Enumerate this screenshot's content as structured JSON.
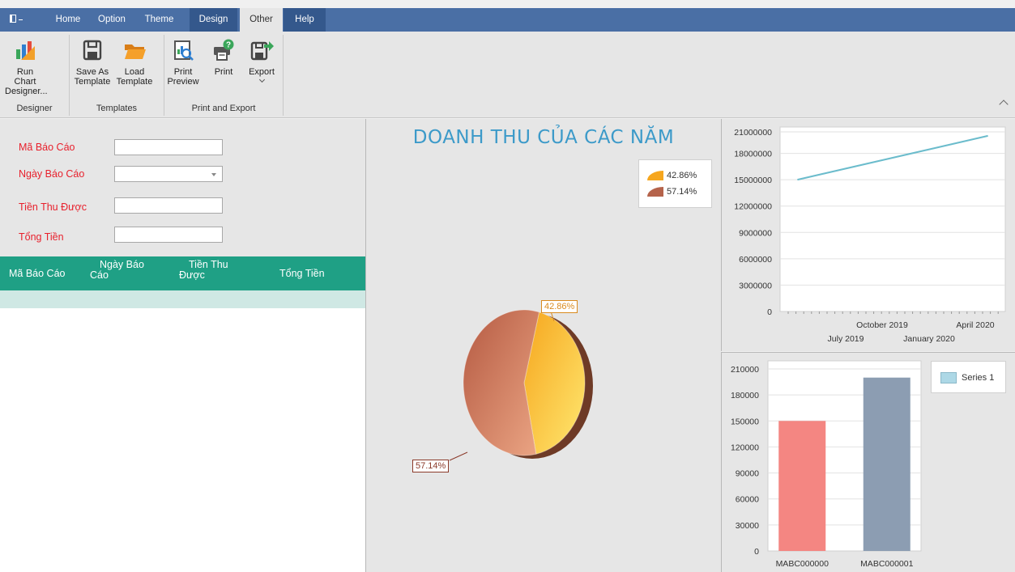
{
  "ribbon": {
    "tabs": [
      {
        "label": "Home"
      },
      {
        "label": "Option"
      },
      {
        "label": "Theme"
      },
      {
        "label": "Design"
      },
      {
        "label": "Other"
      },
      {
        "label": "Help"
      }
    ],
    "buttons": {
      "run_chart_designer": {
        "line1": "Run Chart",
        "line2": "Designer..."
      },
      "save_as_template": {
        "line1": "Save As",
        "line2": "Template"
      },
      "load_template": {
        "line1": "Load",
        "line2": "Template"
      },
      "print_preview": {
        "line1": "Print",
        "line2": "Preview"
      },
      "print": {
        "line1": "Print"
      },
      "export": {
        "line1": "Export"
      }
    },
    "groups": {
      "designer": "Designer",
      "templates": "Templates",
      "print_export": "Print and Export"
    }
  },
  "form": {
    "ma_bao_cao": {
      "label": "Mã Báo Cáo",
      "value": ""
    },
    "ngay_bao_cao": {
      "label": "Ngày Báo Cáo",
      "value": ""
    },
    "tien_thu_duoc": {
      "label": "Tiền Thu Được",
      "value": ""
    },
    "tong_tien": {
      "label": "Tổng Tiền",
      "value": ""
    }
  },
  "grid": {
    "columns": [
      {
        "line1": "Mã Báo Cáo",
        "line2": ""
      },
      {
        "line1": "Ngày Báo",
        "line2": "Cáo"
      },
      {
        "line1": "Tiền Thu",
        "line2": "Được"
      },
      {
        "line1": "Tổng Tiền",
        "line2": ""
      }
    ]
  },
  "chart_data": [
    {
      "type": "pie",
      "title": "DOANH THU CỦA CÁC NĂM",
      "slices": [
        {
          "label": "42.86%",
          "value": 42.86,
          "color": "#f6b52a"
        },
        {
          "label": "57.14%",
          "value": 57.14,
          "color": "#b5634b"
        }
      ],
      "legend": [
        "42.86%",
        "57.14%"
      ],
      "legend_position": "top-right"
    },
    {
      "type": "line",
      "x_tick_labels_top": [
        "October 2019",
        "April 2020"
      ],
      "x_tick_labels_bottom": [
        "July 2019",
        "January 2020"
      ],
      "y_ticks": [
        0,
        3000000,
        6000000,
        9000000,
        12000000,
        15000000,
        18000000,
        21000000
      ],
      "ylim": [
        0,
        21000000
      ],
      "series": [
        {
          "x": [
            "2019-06",
            "2020-05"
          ],
          "values": [
            15000000,
            20000000
          ],
          "color": "#6bbccc"
        }
      ]
    },
    {
      "type": "bar",
      "categories": [
        "MABC000000",
        "MABC000001"
      ],
      "values": [
        150000,
        200000
      ],
      "bar_colors": [
        "#f48682",
        "#8c9db2"
      ],
      "y_ticks": [
        0,
        30000,
        60000,
        90000,
        120000,
        150000,
        180000,
        210000
      ],
      "ylim": [
        0,
        210000
      ],
      "legend": [
        "Series 1"
      ],
      "legend_color": "#add8e6",
      "legend_position": "top-right"
    }
  ]
}
